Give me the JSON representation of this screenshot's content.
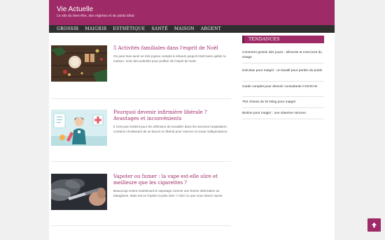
{
  "site": {
    "title": "Vie Actuelle",
    "tagline": "Le site du bien-être, des régimes et du poids idéal"
  },
  "nav": [
    "GROSSIR",
    "MAIGRIR",
    "ESTHÉTIQUE",
    "SANTÉ",
    "MAISON",
    "ARGENT"
  ],
  "posts": [
    {
      "title": "5 Activités familiales dans l'esprit de Noël",
      "excerpt": "On peut tous avoir un très joyeux compte à rebours jusqu'à Noël sans quitter la maison. Voici des activités pour profiter de l'esprit de Noël."
    },
    {
      "title": "Pourquoi devenir infirmière libérale ? Avantages et inconvénients",
      "excerpt": "Il n'est pas évident pour les infirmiers de travailler dans les services hospitaliers. Certains choisissent de se lancer en libéral pour exercer en toute indépendance."
    },
    {
      "title": "Vapoter ou fumer : la vape est-elle sûre et meilleure que les cigarettes ?",
      "excerpt": "Beaucoup voient maintenant le vapotage comme une bonne alternative au tabagisme. Mais est-ce l'option la plus sûre ? Voici ce que vous devez savoir."
    }
  ],
  "sidebar": {
    "heading": "TENDANCES",
    "items": [
      "Comment grossir des joues : aliments et exercices du visage",
      "Dulcolax pour maigrir : un laxatif pour perdre du poids",
      "Guide complet pour devenir consultante CHOGAN",
      "Thé chinois du Dr Ming pour maigrir",
      "Biotine pour maigrir : une vitamine minceur"
    ]
  },
  "icons": {
    "back_to_top": "arrow-up-icon"
  },
  "colors": {
    "brand": "#9e2a67",
    "nav_bg": "#2f2f2f",
    "page_bg": "#f0f0f0"
  }
}
